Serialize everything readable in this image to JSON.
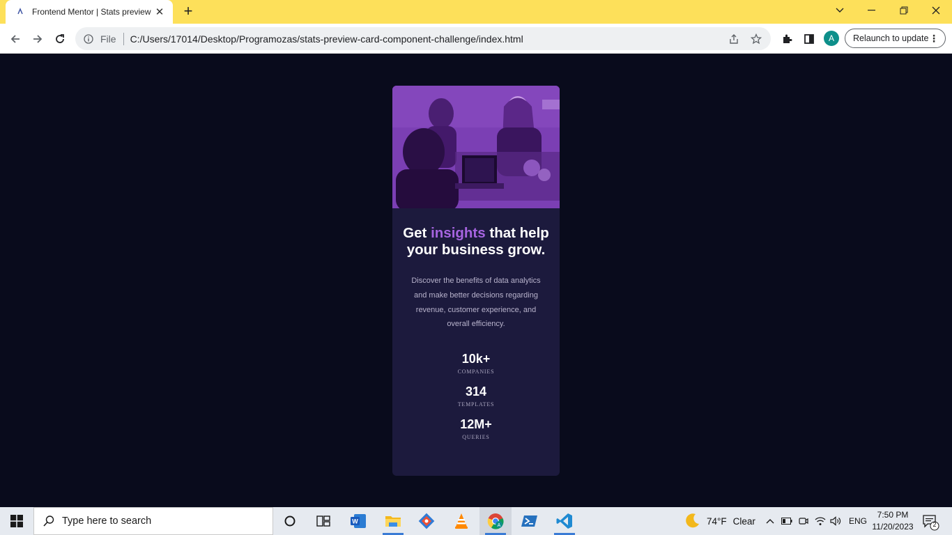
{
  "browser": {
    "tab": {
      "title": "Frontend Mentor | Stats preview card component",
      "favicon": "frontend-mentor-favicon"
    },
    "new_tab_icon": "plus-icon",
    "window_controls": [
      "tab-search-icon",
      "minimize-icon",
      "restore-icon",
      "close-icon"
    ],
    "address_bar": {
      "scheme_label": "File",
      "url": "C:/Users/17014/Desktop/Programozas/stats-preview-card-component-challenge/index.html"
    },
    "profile_initial": "A",
    "relaunch_label": "Relaunch to update"
  },
  "card": {
    "headline": {
      "before": "Get ",
      "accent": "insights",
      "after": " that help your business grow."
    },
    "description": "Discover the benefits of data analytics and make better decisions regarding revenue, customer experience, and overall efficiency.",
    "stats": [
      {
        "value": "10k+",
        "label": "COMPANIES"
      },
      {
        "value": "314",
        "label": "TEMPLATES"
      },
      {
        "value": "12M+",
        "label": "QUERIES"
      }
    ],
    "colors": {
      "accent": "#a664e0",
      "card_bg": "#1c1a3d",
      "page_bg": "#090b1c",
      "image_tint": "#7a3fb3"
    }
  },
  "taskbar": {
    "search_placeholder": "Type here to search",
    "apps": [
      "cortana-icon",
      "task-view-icon",
      "word-icon",
      "file-explorer-icon",
      "git-icon",
      "vlc-icon",
      "chrome-icon",
      "powershell-icon",
      "vscode-icon"
    ],
    "weather": {
      "temp": "74°F",
      "condition": "Clear"
    },
    "language": "ENG",
    "time": "7:50 PM",
    "date": "11/20/2023",
    "notification_count": "2"
  }
}
